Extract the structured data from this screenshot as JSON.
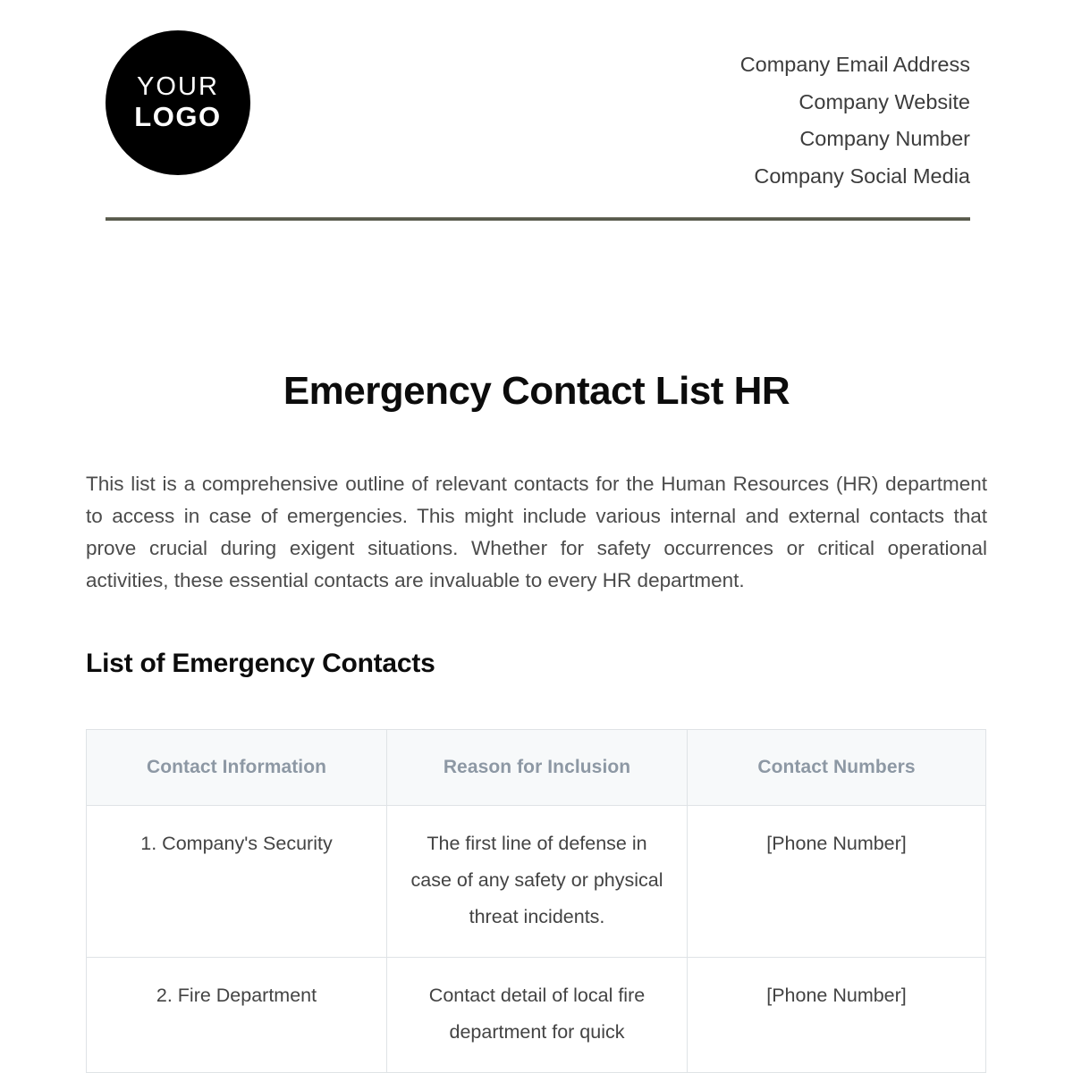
{
  "header": {
    "logo": {
      "line1": "YOUR",
      "line2": "LOGO"
    },
    "contact_lines": [
      "Company Email Address",
      "Company Website",
      "Company Number",
      "Company Social Media"
    ]
  },
  "document": {
    "title": "Emergency Contact List HR",
    "intro": "This list is a comprehensive outline of relevant contacts for the Human Resources (HR) department to access in case of emergencies. This might include various internal and external contacts that prove crucial during exigent situations. Whether for safety occurrences or critical operational activities, these essential contacts are invaluable to every HR department.",
    "section_heading": "List of Emergency Contacts"
  },
  "table": {
    "columns": [
      "Contact Information",
      "Reason for Inclusion",
      "Contact Numbers"
    ],
    "rows": [
      {
        "contact": "1. Company's Security",
        "reason": "The first line of defense in case of any safety or physical threat incidents.",
        "number": "[Phone Number]"
      },
      {
        "contact": "2. Fire Department",
        "reason": "Contact detail of local fire department for quick",
        "number": "[Phone Number]"
      }
    ]
  },
  "colors": {
    "rule": "#585a4c",
    "logo_background": "#000000",
    "table_header_background": "#f7f9fa",
    "table_header_text": "#8d98a4",
    "table_border": "#dfe3e6",
    "body_text": "#4b4b4b",
    "title_text": "#0c0c0c"
  }
}
